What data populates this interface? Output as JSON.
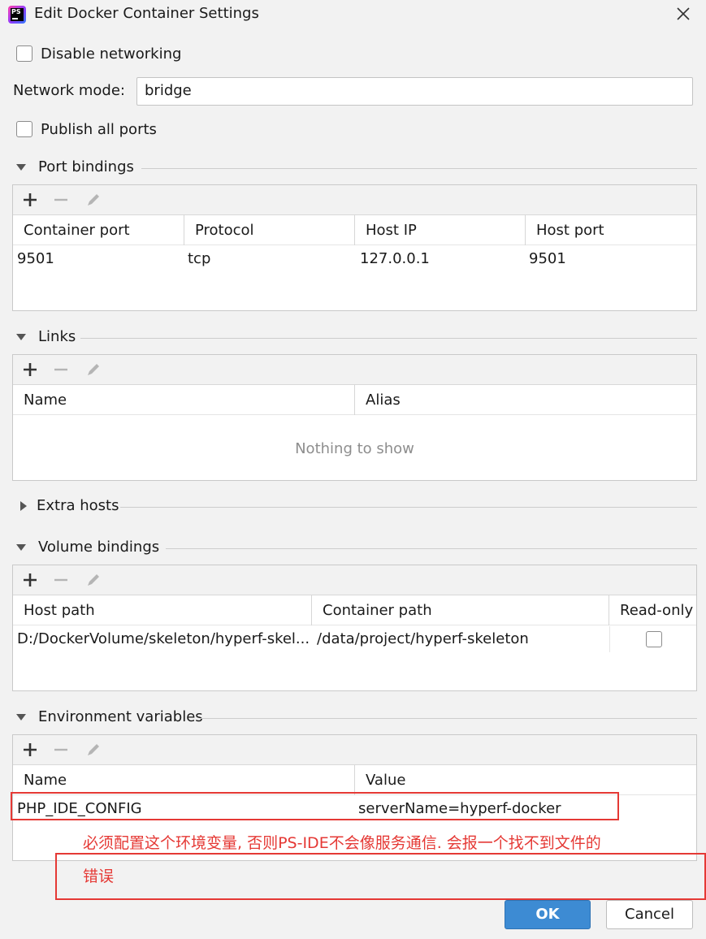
{
  "window": {
    "title": "Edit Docker Container Settings"
  },
  "network": {
    "disable_networking_label": "Disable networking",
    "disable_networking_checked": false,
    "mode_label": "Network mode:",
    "mode_value": "bridge",
    "publish_all_ports_label": "Publish all ports",
    "publish_all_ports_checked": false
  },
  "port_bindings": {
    "title": "Port bindings",
    "columns": [
      "Container port",
      "Protocol",
      "Host IP",
      "Host port"
    ],
    "rows": [
      {
        "container_port": "9501",
        "protocol": "tcp",
        "host_ip": "127.0.0.1",
        "host_port": "9501"
      }
    ]
  },
  "links": {
    "title": "Links",
    "columns": [
      "Name",
      "Alias"
    ],
    "empty_text": "Nothing to show"
  },
  "extra_hosts": {
    "title": "Extra hosts"
  },
  "volume_bindings": {
    "title": "Volume bindings",
    "columns": [
      "Host path",
      "Container path",
      "Read-only"
    ],
    "rows": [
      {
        "host_path": "D:/DockerVolume/skeleton/hyperf-skel...",
        "container_path": "/data/project/hyperf-skeleton",
        "read_only": false
      }
    ]
  },
  "env_vars": {
    "title": "Environment variables",
    "columns": [
      "Name",
      "Value"
    ],
    "rows": [
      {
        "name": "PHP_IDE_CONFIG",
        "value": "serverName=hyperf-docker"
      }
    ]
  },
  "annotation": {
    "line1": "必须配置这个环境变量, 否则PS-IDE不会像服务通信. 会报一个找不到文件的",
    "line2": "错误"
  },
  "buttons": {
    "ok": "OK",
    "cancel": "Cancel"
  },
  "colors": {
    "annotation_red": "#e53935",
    "ok_blue": "#3d8bd3"
  }
}
